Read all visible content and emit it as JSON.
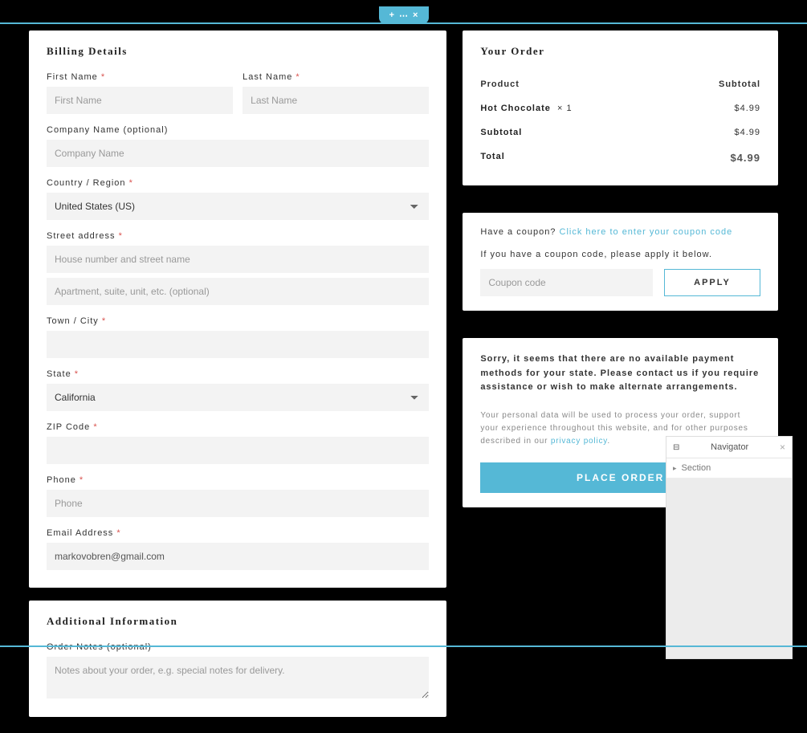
{
  "nav": {
    "item1": "",
    "item2": "",
    "item3": ""
  },
  "handle": {
    "plus": "+",
    "grip": "⋯",
    "close": "×"
  },
  "billing": {
    "title": "Billing Details",
    "first_name": {
      "label": "First Name",
      "placeholder": "First Name",
      "value": ""
    },
    "last_name": {
      "label": "Last Name",
      "placeholder": "Last Name",
      "value": ""
    },
    "company": {
      "label": "Company Name (optional)",
      "placeholder": "Company Name",
      "value": ""
    },
    "country": {
      "label": "Country / Region",
      "value": "United States (US)"
    },
    "street": {
      "label": "Street address",
      "placeholder1": "House number and street name",
      "placeholder2": "Apartment, suite, unit, etc. (optional)"
    },
    "city": {
      "label": "Town / City",
      "value": ""
    },
    "state": {
      "label": "State",
      "value": "California"
    },
    "zip": {
      "label": "ZIP Code",
      "value": ""
    },
    "phone": {
      "label": "Phone",
      "placeholder": "Phone",
      "value": ""
    },
    "email": {
      "label": "Email Address",
      "value": "markovobren@gmail.com"
    }
  },
  "additional": {
    "title": "Additional Information",
    "notes": {
      "label": "Order Notes (optional)",
      "placeholder": "Notes about your order, e.g. special notes for delivery."
    }
  },
  "order": {
    "title": "Your Order",
    "header": {
      "product": "Product",
      "subtotal": "Subtotal"
    },
    "item": {
      "name": "Hot Chocolate",
      "qty": "× 1",
      "price": "$4.99"
    },
    "subtotal": {
      "label": "Subtotal",
      "value": "$4.99"
    },
    "total": {
      "label": "Total",
      "value": "$4.99"
    }
  },
  "coupon": {
    "question": "Have a coupon?",
    "link": "Click here to enter your coupon code",
    "note": "If you have a coupon code, please apply it below.",
    "placeholder": "Coupon code",
    "apply": "APPLY"
  },
  "payment": {
    "notice": "Sorry, it seems that there are no available payment methods for your state. Please contact us if you require assistance or wish to make alternate arrangements.",
    "privacy_pre": "Your personal data will be used to process your order, support your experience throughout this website, and for other purposes described in our ",
    "privacy_link": "privacy policy",
    "privacy_post": ".",
    "place_order": "PLACE ORDER"
  },
  "navigator": {
    "title": "Navigator",
    "item": "Section"
  }
}
